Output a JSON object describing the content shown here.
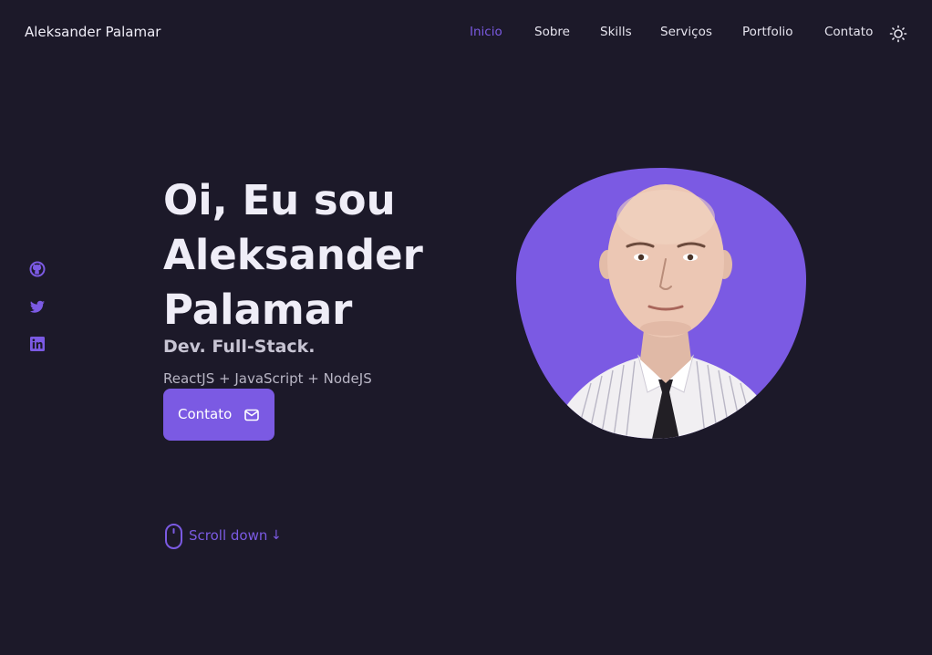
{
  "header": {
    "logo": "Aleksander Palamar",
    "nav": [
      {
        "label": "Inicio",
        "active": true
      },
      {
        "label": "Sobre",
        "active": false
      },
      {
        "label": "Skills",
        "active": false
      },
      {
        "label": "Serviços",
        "active": false
      },
      {
        "label": "Portfolio",
        "active": false
      },
      {
        "label": "Contato",
        "active": false
      }
    ],
    "theme_icon": "sun-icon"
  },
  "social": [
    {
      "icon": "github-icon"
    },
    {
      "icon": "twitter-icon"
    },
    {
      "icon": "linkedin-icon"
    }
  ],
  "hero": {
    "title_lines": [
      "Oi, Eu sou",
      "Aleksander",
      "Palamar"
    ],
    "subtitle": "Dev. Full-Stack.",
    "description": "ReactJS + JavaScript + NodeJS",
    "button_label": "Contato",
    "button_icon": "mail-icon"
  },
  "scroll": {
    "label": "Scroll down",
    "arrow": "↓",
    "icon": "mouse-icon"
  },
  "colors": {
    "background": "#1c1929",
    "accent": "#7b5ae3",
    "text": "#efedf7"
  }
}
